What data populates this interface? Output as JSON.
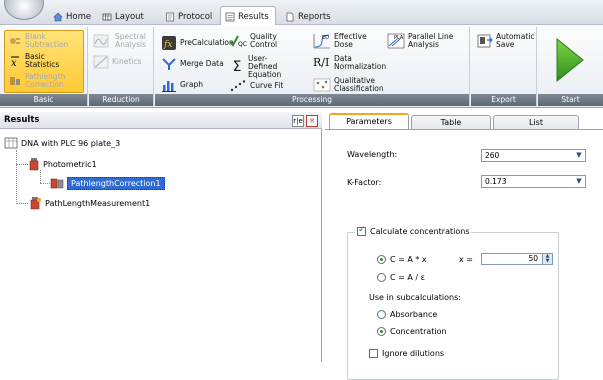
{
  "tabs": [
    {
      "label": "Home",
      "icon": "home-icon"
    },
    {
      "label": "Layout",
      "icon": "layout-icon"
    },
    {
      "label": "Protocol",
      "icon": "protocol-icon"
    },
    {
      "label": "Results",
      "icon": "results-icon",
      "active": true
    },
    {
      "label": "Reports",
      "icon": "reports-icon"
    }
  ],
  "ribbon": {
    "basic": {
      "label": "Basic",
      "blank_subtraction": "Blank Subtraction",
      "basic_statistics": "Basic Statistics",
      "pathlength_correction": "Pathlength Correction"
    },
    "reduction": {
      "label": "Reduction",
      "spectral_analysis": "Spectral Analysis",
      "kinetics": "Kinetics"
    },
    "processing": {
      "label": "Processing",
      "precalculation": "PreCalculation",
      "merge_data": "Merge Data",
      "graph": "Graph",
      "quality_control": "Quality Control",
      "user_defined_equation": "User-Defined Equation",
      "curve_fit": "Curve Fit",
      "effective_dose": "Effective Dose",
      "data_normalization": "Data Normalization",
      "qualitative_classification": "Qualitative Classification",
      "parallel_line_analysis": "Parallel Line Analysis",
      "ed_badge": "ED",
      "pla_badge": "PLA",
      "qc_badge": "QC",
      "ri_badge": "R/I",
      "sigma": "Σ"
    },
    "export": {
      "label": "Export",
      "automatic_save": "Automatic Save"
    },
    "start": {
      "label": "Start"
    }
  },
  "results": {
    "title": "Results",
    "tree": {
      "root": "DNA with PLC 96 plate_3",
      "photometric": "Photometric1",
      "pathlength_correction": "PathlengthCorrection1",
      "pathlength_measurement": "PathLengthMeasurement1"
    },
    "header_btn_label": "r|e"
  },
  "right_panel": {
    "tabs": [
      "Parameters",
      "Table",
      "List"
    ],
    "wavelength_label": "Wavelength:",
    "wavelength_value": "260",
    "kfactor_label": "K-Factor:",
    "kfactor_value": "0.173",
    "calc_conc_label": "Calculate concentrations",
    "formula1": "C = A * x",
    "formula2": "C = A / ε",
    "x_label": "x =",
    "x_value": "50",
    "use_in_sub_label": "Use in subcalculations:",
    "absorbance": "Absorbance",
    "concentration": "Concentration",
    "ignore_dilutions": "Ignore dilutions"
  },
  "colors": {
    "accent": "#f2a627",
    "selection": "#2f6bd2",
    "start_green": "#4caf26",
    "group_bar": "#6b7682"
  }
}
